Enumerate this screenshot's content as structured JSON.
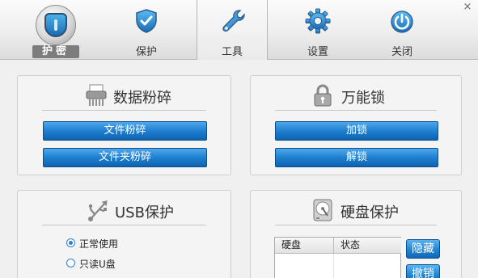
{
  "header": {
    "logo_label": "护密",
    "tabs": [
      {
        "label": "保护",
        "icon": "shield-icon"
      },
      {
        "label": "工具",
        "icon": "wrench-icon"
      },
      {
        "label": "设置",
        "icon": "gear-icon"
      },
      {
        "label": "关闭",
        "icon": "power-icon"
      }
    ],
    "active_tab": "工具",
    "close_glyph": "×"
  },
  "shred": {
    "title": "数据粉碎",
    "icon": "shredder-icon",
    "buttons": [
      "文件粉碎",
      "文件夹粉碎"
    ]
  },
  "lock": {
    "title": "万能锁",
    "icon": "padlock-icon",
    "buttons": [
      "加锁",
      "解锁"
    ]
  },
  "usb": {
    "title": "USB保护",
    "icon": "usb-icon",
    "options": [
      {
        "label": "正常使用",
        "checked": true
      },
      {
        "label": "只读U盘",
        "checked": false
      }
    ]
  },
  "disk": {
    "title": "硬盘保护",
    "icon": "hard-disk-icon",
    "columns": [
      "硬盘",
      "状态"
    ],
    "buttons": [
      "隐藏",
      "撤销"
    ]
  },
  "colors": {
    "button_blue": "#1f7fd0",
    "radio_blue": "#2f7fd0"
  }
}
